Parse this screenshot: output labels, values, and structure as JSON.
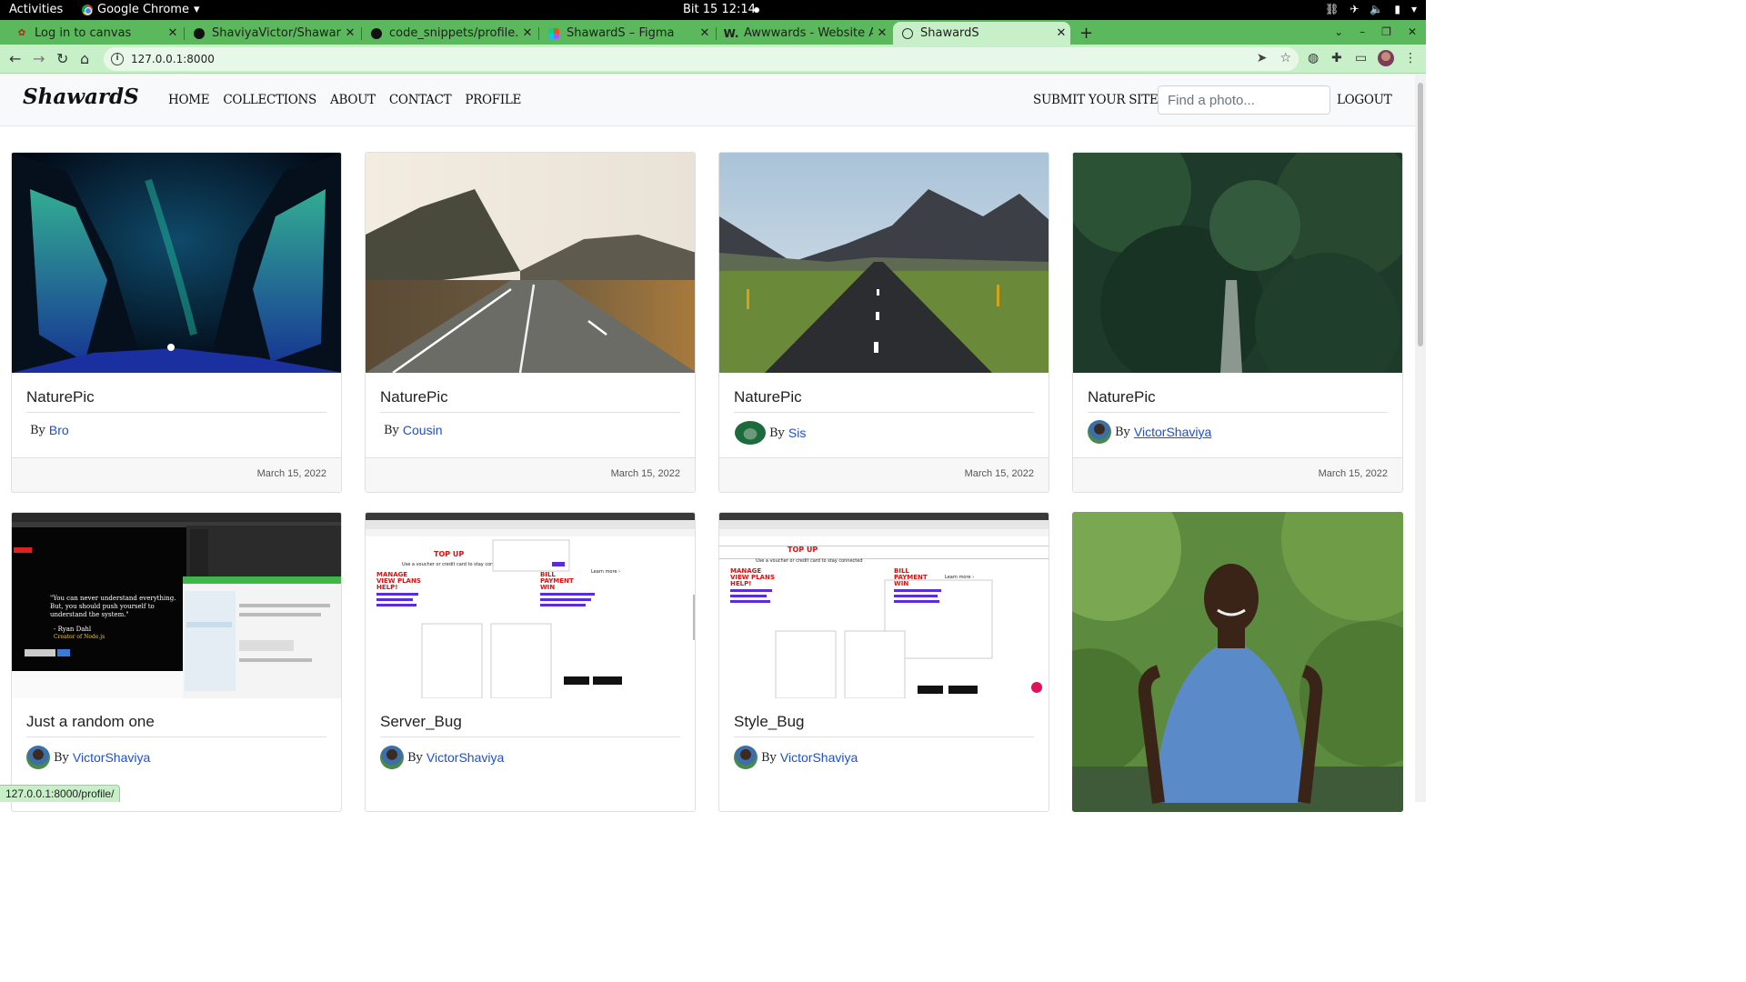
{
  "system_bar": {
    "activities": "Activities",
    "app_name": "Google Chrome",
    "clock": "Bit 15  12:14"
  },
  "browser": {
    "tabs": [
      {
        "title": "Log in to canvas",
        "icon": "canvas-icon"
      },
      {
        "title": "ShaviyaVictor/ShawardS",
        "icon": "github-icon"
      },
      {
        "title": "code_snippets/profile.htm",
        "icon": "github-icon"
      },
      {
        "title": "ShawardS – Figma",
        "icon": "figma-icon"
      },
      {
        "title": "Awwwards - Website Awa",
        "icon": "awwwards-icon"
      },
      {
        "title": "ShawardS",
        "icon": "globe-icon",
        "active": true
      }
    ],
    "url": "127.0.0.1:8000",
    "status_url": "127.0.0.1:8000/profile/"
  },
  "site": {
    "brand": "ShawardS",
    "nav": [
      "HOME",
      "COLLECTIONS",
      "ABOUT",
      "CONTACT",
      "PROFILE"
    ],
    "submit": "SUBMIT YOUR SITE!",
    "search_placeholder": "Find a photo...",
    "logout": "LOGOUT"
  },
  "cards": [
    {
      "title": "NaturePic",
      "by": "By",
      "author": "Bro",
      "date": "March 15, 2022",
      "image": "aurora-ice-cave"
    },
    {
      "title": "NaturePic",
      "by": "By",
      "author": "Cousin",
      "date": "March 15, 2022",
      "image": "misty-road-mountains"
    },
    {
      "title": "NaturePic",
      "by": "By",
      "author": "Sis",
      "date": "March 15, 2022",
      "image": "road-to-mountains"
    },
    {
      "title": "NaturePic",
      "by": "By",
      "author": "VictorShaviya",
      "date": "March 15, 2022",
      "image": "forest-boardwalk"
    },
    {
      "title": "Just a random one",
      "by": "By",
      "author": "VictorShaviya",
      "image": "desktop-screenshot"
    },
    {
      "title": "Server_Bug",
      "by": "By",
      "author": "VictorShaviya",
      "image": "bug-screenshot"
    },
    {
      "title": "Style_Bug",
      "by": "By",
      "author": "VictorShaviya",
      "image": "bug-screenshot"
    },
    {
      "title": "",
      "image": "portrait-in-garden"
    }
  ],
  "screenshot_text": {
    "quote_lines": [
      "\"You can never understand everything.",
      "But, you should push yourself to",
      "understand the system.\""
    ],
    "quote_author": "- Ryan Dahl",
    "quote_role": "Creator of Node.js",
    "top_up": "TOP UP",
    "top_up_sub": "Use a voucher or credit card to stay connected",
    "manage": [
      "MANAGE",
      "VIEW PLANS",
      "HELP!"
    ],
    "bill": [
      "BILL",
      "PAYMENT",
      "WIN"
    ],
    "learn_more": "Learn more ›"
  },
  "colors": {
    "tabstrip": "#5cb85c",
    "toolbar": "#c8f0c8",
    "link": "#1a4fd8"
  }
}
